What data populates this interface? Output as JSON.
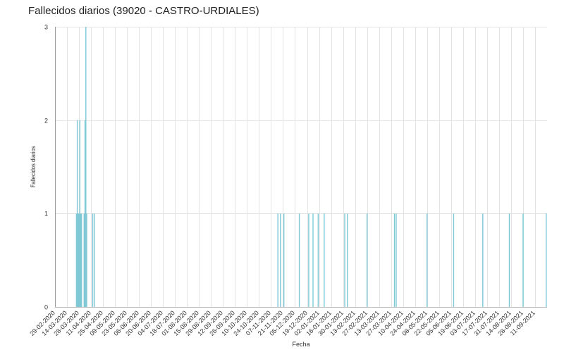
{
  "chart_data": {
    "type": "bar",
    "title": "Fallecidos diarios (39020 - CASTRO-URDIALES)",
    "xlabel": "Fecha",
    "ylabel": "Fallecidos diarios",
    "ylim": [
      0,
      3
    ],
    "yticks": [
      0,
      1,
      2,
      3
    ],
    "xlim": [
      "2020-02-29",
      "2021-09-25"
    ],
    "xticks": [
      "29-02-2020",
      "14-03-2020",
      "28-03-2020",
      "11-04-2020",
      "25-04-2020",
      "09-05-2020",
      "23-05-2020",
      "06-06-2020",
      "20-06-2020",
      "04-07-2020",
      "18-07-2020",
      "01-08-2020",
      "15-08-2020",
      "29-08-2020",
      "12-09-2020",
      "26-09-2020",
      "10-10-2020",
      "24-10-2020",
      "07-11-2020",
      "21-11-2020",
      "05-12-2020",
      "19-12-2020",
      "02-01-2021",
      "16-01-2021",
      "30-01-2021",
      "13-02-2021",
      "27-02-2021",
      "13-03-2021",
      "27-03-2021",
      "10-04-2021",
      "24-04-2021",
      "08-05-2021",
      "22-05-2021",
      "05-06-2021",
      "19-06-2021",
      "03-07-2021",
      "17-07-2021",
      "31-07-2021",
      "14-08-2021",
      "28-08-2021",
      "11-09-2021"
    ],
    "grid": true,
    "color": "#7ec8d6",
    "points": [
      {
        "date": "2020-03-25",
        "value": 1
      },
      {
        "date": "2020-03-26",
        "value": 2
      },
      {
        "date": "2020-03-27",
        "value": 1
      },
      {
        "date": "2020-03-28",
        "value": 1
      },
      {
        "date": "2020-03-29",
        "value": 2
      },
      {
        "date": "2020-03-30",
        "value": 1
      },
      {
        "date": "2020-03-31",
        "value": 1
      },
      {
        "date": "2020-04-03",
        "value": 1
      },
      {
        "date": "2020-04-04",
        "value": 2
      },
      {
        "date": "2020-04-05",
        "value": 3
      },
      {
        "date": "2020-04-06",
        "value": 1
      },
      {
        "date": "2020-04-13",
        "value": 1
      },
      {
        "date": "2020-04-15",
        "value": 1
      },
      {
        "date": "2020-11-15",
        "value": 1
      },
      {
        "date": "2020-11-18",
        "value": 1
      },
      {
        "date": "2020-11-22",
        "value": 1
      },
      {
        "date": "2020-12-10",
        "value": 1
      },
      {
        "date": "2020-12-21",
        "value": 1
      },
      {
        "date": "2020-12-26",
        "value": 1
      },
      {
        "date": "2021-01-01",
        "value": 1
      },
      {
        "date": "2021-01-08",
        "value": 1
      },
      {
        "date": "2021-02-01",
        "value": 1
      },
      {
        "date": "2021-02-04",
        "value": 1
      },
      {
        "date": "2021-02-27",
        "value": 1
      },
      {
        "date": "2021-03-31",
        "value": 1
      },
      {
        "date": "2021-04-02",
        "value": 1
      },
      {
        "date": "2021-05-08",
        "value": 1
      },
      {
        "date": "2021-06-08",
        "value": 1
      },
      {
        "date": "2021-07-12",
        "value": 1
      },
      {
        "date": "2021-08-12",
        "value": 1
      },
      {
        "date": "2021-08-28",
        "value": 1
      },
      {
        "date": "2021-09-24",
        "value": 1
      }
    ]
  }
}
